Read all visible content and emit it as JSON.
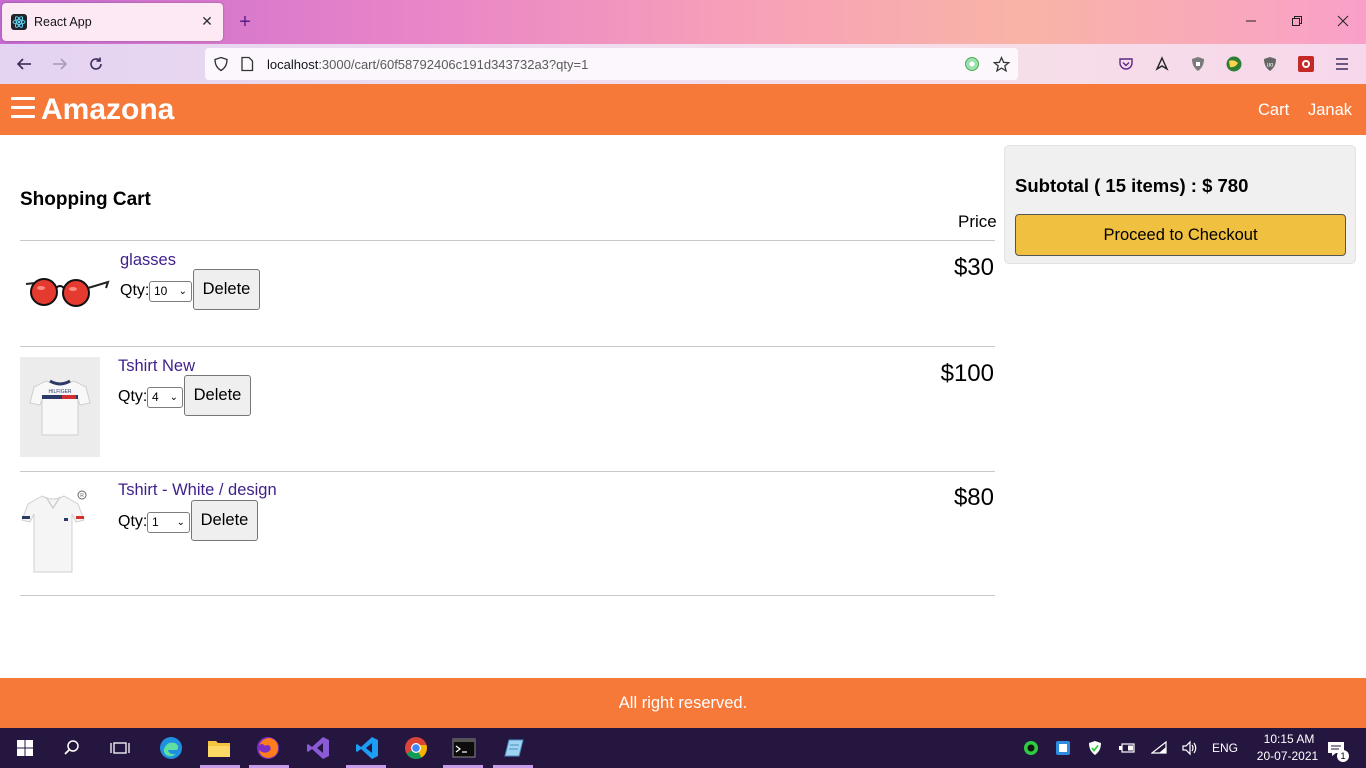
{
  "browser": {
    "tab_title": "React App",
    "tab_close_glyph": "✕",
    "new_tab_glyph": "+",
    "url_host": "localhost",
    "url_rest": ":3000/cart/60f58792406c191d343732a3?qty=1"
  },
  "header": {
    "brand": "Amazona",
    "cart_link": "Cart",
    "user_link": "Janak"
  },
  "cart": {
    "title": "Shopping Cart",
    "price_header": "Price",
    "qty_label": "Qty:",
    "delete_label": "Delete",
    "items": [
      {
        "name": "glasses",
        "qty": "10",
        "price": "$30"
      },
      {
        "name": "Tshirt New",
        "qty": "4",
        "price": "$100"
      },
      {
        "name": "Tshirt - White / design",
        "qty": "1",
        "price": "$80"
      }
    ]
  },
  "summary": {
    "subtotal": "Subtotal ( 15 items) : $ 780",
    "checkout_label": "Proceed to Checkout"
  },
  "footer": {
    "text": "All right reserved."
  },
  "taskbar": {
    "language": "ENG",
    "time": "10:15 AM",
    "date": "20-07-2021",
    "notification_count": "1"
  },
  "colors": {
    "brand_orange": "#f7793a",
    "checkout_yellow": "#f0c040",
    "link_purple": "#3f1f8a"
  }
}
